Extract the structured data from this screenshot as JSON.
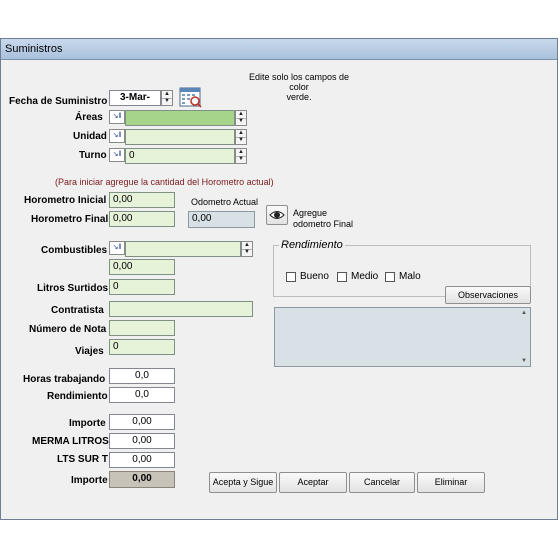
{
  "window": {
    "title": "Suministros"
  },
  "instructions": {
    "line1": "Edite solo los campos de color",
    "line2": "verde."
  },
  "labels": {
    "fecha": "Fecha de Suministro",
    "areas": "Áreas",
    "unidad": "Unidad",
    "turno": "Turno",
    "hint": "(Para iniciar agregue la cantidad del Horometro actual)",
    "horometro_inicial": "Horometro Inicial",
    "horometro_final": "Horometro Final",
    "odometro_actual": "Odometro Actual",
    "agregue_line1": "Agregue",
    "agregue_line2": "odometro Final",
    "combustibles": "Combustibles",
    "litros_surtidos": "Litros Surtidos",
    "contratista": "Contratista",
    "numero_nota": "Número de Nota",
    "viajes": "Viajes",
    "horas_trabajando": "Horas trabajando",
    "rendimiento": "Rendimiento",
    "importe": "Importe",
    "merma_litros": "MERMA  LITROS",
    "lts_sur_t": "LTS SUR T",
    "importe2": "Importe"
  },
  "values": {
    "fecha": "3-Mar-",
    "areas": "",
    "unidad": "",
    "turno": "0",
    "horometro_inicial": "0,00",
    "horometro_final": "0,00",
    "odometro_actual": "0,00",
    "combustibles": "",
    "combustibles_qty": "0,00",
    "litros_surtidos": "0",
    "contratista": "",
    "numero_nota": "",
    "viajes": "0",
    "horas_trabajando": "0,0",
    "rendimiento": "0,0",
    "importe": "0,00",
    "merma_litros": "0,00",
    "lts_sur_t": "0,00",
    "importe2": "0,00",
    "observaciones_text": ""
  },
  "rendimiento_group": {
    "title": "Rendimiento",
    "options": [
      "Bueno",
      "Medio",
      "Malo"
    ]
  },
  "buttons": {
    "observaciones": "Observaciones",
    "acepta_sigue": "Acepta y Sigue",
    "aceptar": "Aceptar",
    "cancelar": "Cancelar",
    "eliminar": "Eliminar"
  },
  "icons": {
    "calendar": "calendar-icon",
    "eye": "eye-icon",
    "lookup": "lookup-icon"
  },
  "colors": {
    "editable_field": "#e6f3d9",
    "selected_field": "#a6d48a",
    "readonly_field": "#d8e2e6"
  }
}
